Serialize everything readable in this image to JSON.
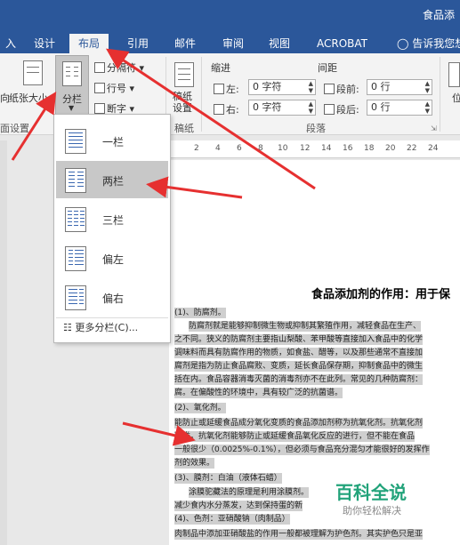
{
  "titlebar": {
    "title": "食品添"
  },
  "tabs": [
    {
      "label": "入"
    },
    {
      "label": "设计"
    },
    {
      "label": "布局"
    },
    {
      "label": "引用"
    },
    {
      "label": "邮件"
    },
    {
      "label": "审阅"
    },
    {
      "label": "视图"
    },
    {
      "label": "ACROBAT"
    },
    {
      "label": "告诉我您想"
    }
  ],
  "ribbon": {
    "left_cut": "向",
    "paper_size": "纸张大小",
    "columns": "分栏",
    "breaks": "分隔符",
    "line_numbers": "行号",
    "hyphenation": "断字",
    "page_setup": "面设置",
    "draft": "稿纸设置",
    "draft_group": "稿纸",
    "indent": "缩进",
    "spacing": "间距",
    "indent_left_label": "左:",
    "indent_left_value": "0 字符",
    "indent_right_label": "右:",
    "indent_right_value": "0 字符",
    "before_label": "段前:",
    "before_value": "0 行",
    "after_label": "段后:",
    "after_value": "0 行",
    "paragraph": "段落",
    "position_cut": "位"
  },
  "ruler": {
    "ticks": [
      "2",
      "4",
      "6",
      "8",
      "10",
      "12",
      "14",
      "16",
      "18",
      "20",
      "22",
      "24"
    ]
  },
  "columns_menu": {
    "items": [
      {
        "label": "一栏"
      },
      {
        "label": "两栏"
      },
      {
        "label": "三栏"
      },
      {
        "label": "偏左"
      },
      {
        "label": "偏右"
      }
    ],
    "more": "更多分栏(C)..."
  },
  "document": {
    "title": "食品添加剂的作用：用于保",
    "lines": [
      "(1)、防腐剂。",
      "防腐剂就是能够抑制微生物或抑制其繁殖作用，减轻食品在生产、",
      "之不同。狭义的防腐剂主要指山梨酸、苯甲酸等直接加入食品中的化学",
      "调味料而具有防腐作用的物质，如食盐、醋等，以及那些通常不直接加",
      "腐剂是指为防止食品腐败、变质，延长食品保存期，抑制食品中的微生",
      "括在内。食品容器消毒灭菌的消毒剂亦不在此列。常见的几种防腐剂：",
      "腐。在偏酸性的环境中，具有较广泛的抗菌谱。",
      "(2)、氧化剂。",
      "能防止或延缓食品成分氧化变质的食品添加剂称为抗氧化剂。抗氧化剂",
      "剂类。抗氧化剂能够防止或延缓食品氧化反应的进行，但不能在食品",
      "一般很少（0.0025%-0.1%），但必须与食品充分混匀才能很好的发挥作",
      "剂的效果。",
      "(3)、膜剂：白油（液体石蜡）",
      "涂膜驼藏法的原理是利用涂膜剂。",
      "减少食内水分蒸发，达到保持蛋的新",
      "(4)、色剂：亚硝酸钠（肉制品）",
      "肉制品中添加亚硝酸盐的作用一般都被理解为护色剂。其实护色只是亚"
    ]
  },
  "watermark": {
    "brand": "百科全说",
    "slogan": "助你轻松解决"
  },
  "colors": {
    "accent": "#2b579a",
    "arrow": "#e63030",
    "watermark": "#22a37a"
  }
}
